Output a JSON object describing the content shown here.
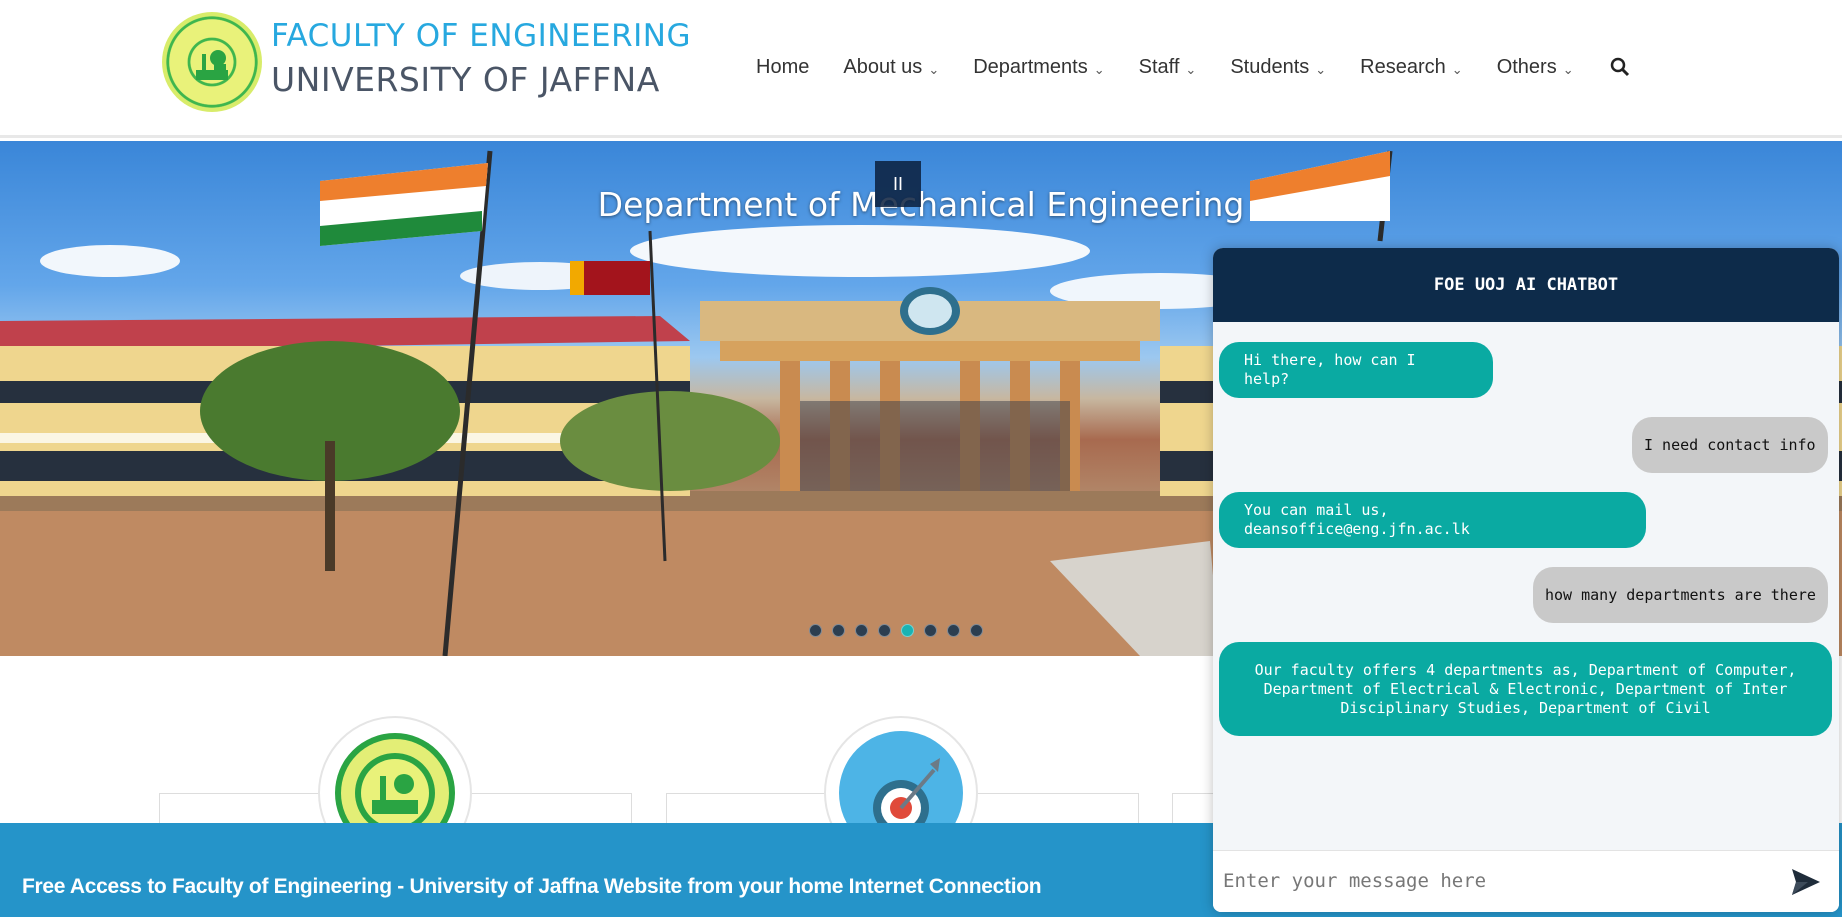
{
  "header": {
    "logo_line1": "FACULTY OF ENGINEERING",
    "logo_line2": "UNIVERSITY OF JAFFNA",
    "nav": [
      {
        "label": "Home",
        "dropdown": false
      },
      {
        "label": "About us",
        "dropdown": true
      },
      {
        "label": "Departments",
        "dropdown": true
      },
      {
        "label": "Staff",
        "dropdown": true
      },
      {
        "label": "Students",
        "dropdown": true
      },
      {
        "label": "Research",
        "dropdown": true
      },
      {
        "label": "Others",
        "dropdown": true
      }
    ],
    "search_icon": "search-icon"
  },
  "hero": {
    "title": "Department of Mechanical Engineering",
    "pause_label": "II",
    "slide_count": 8,
    "active_slide": 5
  },
  "banner": {
    "text": "Free Access to Faculty of Engineering - University of Jaffna Website from your home Internet Connection"
  },
  "chatbot": {
    "title": "FOE UOJ AI CHATBOT",
    "messages": [
      {
        "from": "bot",
        "text": "Hi there, how can I help?"
      },
      {
        "from": "user",
        "text": "I need contact info"
      },
      {
        "from": "bot",
        "text": "You can mail us, deansoffice@eng.jfn.ac.lk"
      },
      {
        "from": "user",
        "text": "how many departments are there"
      },
      {
        "from": "bot",
        "text": "Our faculty offers 4 departments as, Department of Computer, Department of Electrical & Electronic, Department of Inter Disciplinary Studies, Department of Civil"
      }
    ],
    "input_placeholder": "Enter your message here",
    "send_icon": "send-icon"
  },
  "colors": {
    "accent_blue": "#27a8df",
    "banner_blue": "#2594c9",
    "chat_header": "#0d2b4a",
    "bot_bubble": "#0aaaa2",
    "user_bubble": "#c9c9c9"
  }
}
